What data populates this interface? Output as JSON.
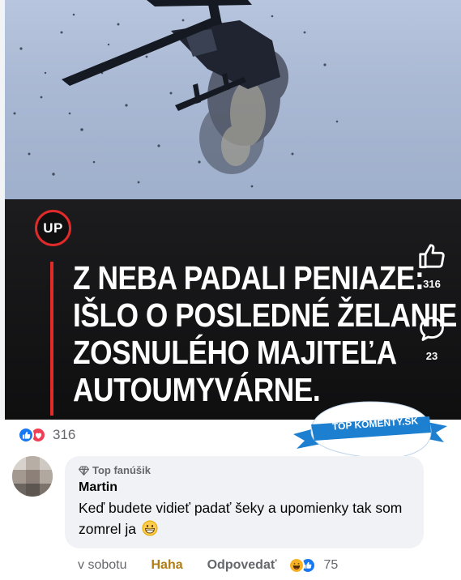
{
  "post": {
    "logo_text": "UP",
    "headline_lines": [
      "Z NEBA PADALI PENIAZE:",
      "IŠLO O POSLEDNÉ ŽELANIE",
      "ZOSNULÉHO MAJITEĽA",
      "AUTOUMYVÁRNE."
    ],
    "like_count": "316",
    "comment_count": "23"
  },
  "reactions": {
    "types": [
      "like",
      "love"
    ],
    "count": "316"
  },
  "badge": {
    "text": "TOP KOMENTY.SK"
  },
  "comment": {
    "badge_label": "Top fanúšik",
    "author": "Martin",
    "text": "Keď budete vidieť padať šeky a upomienky tak som zomrel ja",
    "emoji": "grinning-face",
    "time": "v sobotu",
    "reaction_label": "Haha",
    "reply_label": "Odpovedať",
    "reaction_types": [
      "haha",
      "like"
    ],
    "reaction_count": "75"
  },
  "colors": {
    "accent_red": "#e12a2a",
    "fb_blue": "#1877f2",
    "haha_gold": "#b07c15",
    "badge_blue": "#1d7fd0"
  }
}
